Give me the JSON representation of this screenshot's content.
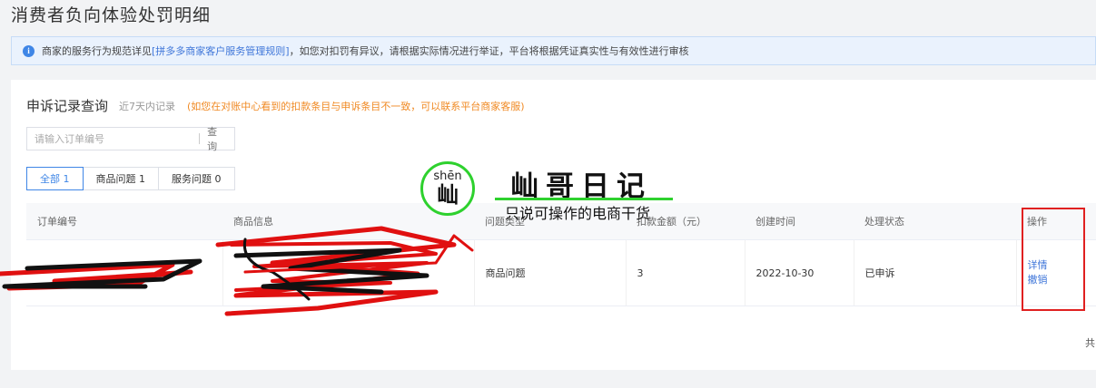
{
  "page": {
    "title": "消费者负向体验处罚明细"
  },
  "notice": {
    "icon": "info-icon",
    "text_before": "商家的服务行为规范详见",
    "link": "[拼多多商家客户服务管理规则]",
    "text_after": "，如您对扣罚有异议，请根据实际情况进行举证，平台将根据凭证真实性与有效性进行审核"
  },
  "appeal": {
    "title": "申诉记录查询",
    "range": "近7天内记录",
    "note": "(如您在对账中心看到的扣款条目与申诉条目不一致，可以联系平台商家客服)"
  },
  "search": {
    "placeholder": "请输入订单编号",
    "button": "查询"
  },
  "tabs": [
    {
      "label": "全部 1",
      "active": true
    },
    {
      "label": "商品问题 1"
    },
    {
      "label": "服务问题 0"
    }
  ],
  "table": {
    "headers": [
      "订单编号",
      "商品信息",
      "问题类型",
      "扣款金额（元）",
      "创建时间",
      "处理状态",
      "操作"
    ],
    "rows": [
      {
        "order_no": "",
        "product": "",
        "issue_type": "商品问题",
        "amount": "3",
        "created": "2022-10-30",
        "status": "已申诉",
        "actions": [
          "详情",
          "撤销"
        ]
      }
    ]
  },
  "pagination": {
    "total_prefix": "共"
  },
  "watermark": {
    "pinyin": "shēn",
    "char": "屾",
    "name": "屾哥日记",
    "slogan": "只说可操作的电商干货",
    "color": "#2ed12e"
  },
  "colors": {
    "accent": "#3f86e6",
    "link": "#3f76d9",
    "warning": "#f08a24",
    "highlight": "#e02020"
  }
}
